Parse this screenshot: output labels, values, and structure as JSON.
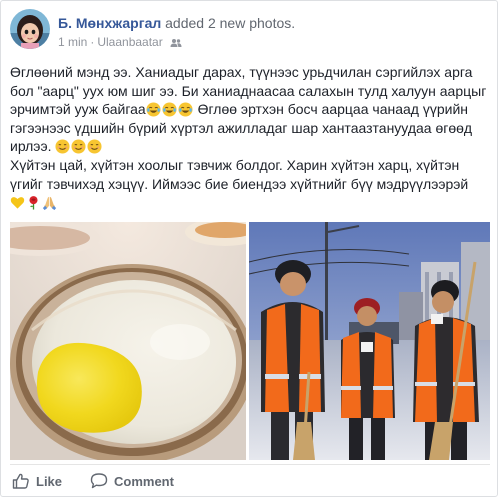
{
  "post": {
    "author": "Б. Мөнхжаргал",
    "action_text": " added 2 new photos.",
    "time": "1 min",
    "separator": "·",
    "location": "Ulaanbaatar",
    "audience_icon": "friends-icon",
    "paragraph1_part1": "Өглөөний мэнд ээ. Ханиадыг дарах, түүнээс урьдчилан сэргийлэх арга бол \"аарц\" уух юм шиг ээ. Би ханиаднаасаа салахын тулд халуун аарцыг эрчимтэй ууж байгаа",
    "paragraph1_part2": " Өглөө эртхэн босч аарцаа чанаад үүрийн гэгээнээс үдшийн бүрий хүртэл ажилладаг шар хантаазтануудаа өгөөд ирлээ. ",
    "paragraph2": "Хүйтэн цай, хүйтэн хоолыг тэвчиж болдог. Харин хүйтэн харц, хүйтэн үгийг тэвчихэд хэцүү. Иймээс бие биендээ хүйтнийг бүү мэдрүүлээрэй",
    "photos": [
      {
        "name": "photo-aarts-bowl",
        "icon": "bowl-photo"
      },
      {
        "name": "photo-street-workers",
        "icon": "workers-photo"
      }
    ],
    "like_label": "Like",
    "comment_label": "Comment"
  },
  "colors": {
    "author": "#365899",
    "meta": "#90949c",
    "text": "#1d2129",
    "action": "#616770"
  }
}
